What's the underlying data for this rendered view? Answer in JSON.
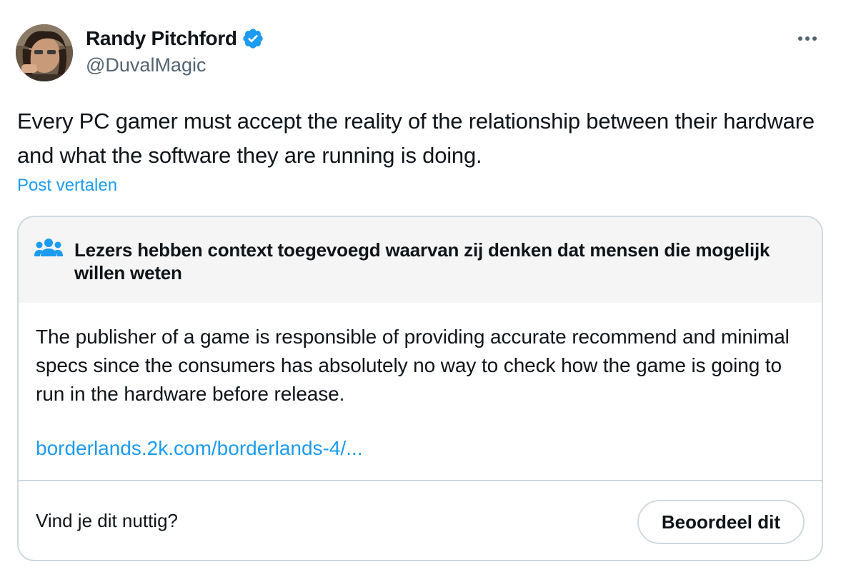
{
  "author": {
    "name": "Randy Pitchford",
    "handle": "@DuvalMagic",
    "verified": true,
    "verified_color": "#1d9bf0"
  },
  "post": {
    "text": "Every PC gamer must accept the reality of the relationship between their hardware and what the software they are running is doing.",
    "translate_label": "Post vertalen"
  },
  "community_note": {
    "title": "Lezers hebben context toegevoegd waarvan zij denken dat mensen die mogelijk willen weten",
    "body": "The publisher of a game is responsible of providing accurate recommend and minimal specs since the consumers has absolutely no way to check how the game is going to run in the hardware before release.",
    "link_text": "borderlands.2k.com/borderlands-4/...",
    "helpful_question": "Vind je dit nuttig?",
    "rate_button_label": "Beoordeel dit",
    "icon": "people-icon"
  },
  "icons": {
    "more": "more-dots-icon",
    "verified": "verified-badge-icon"
  },
  "colors": {
    "accent": "#1d9bf0",
    "text": "#0f1419",
    "secondary_text": "#536471",
    "border": "#cfd9de",
    "note_header_bg": "#f5f5f5"
  }
}
